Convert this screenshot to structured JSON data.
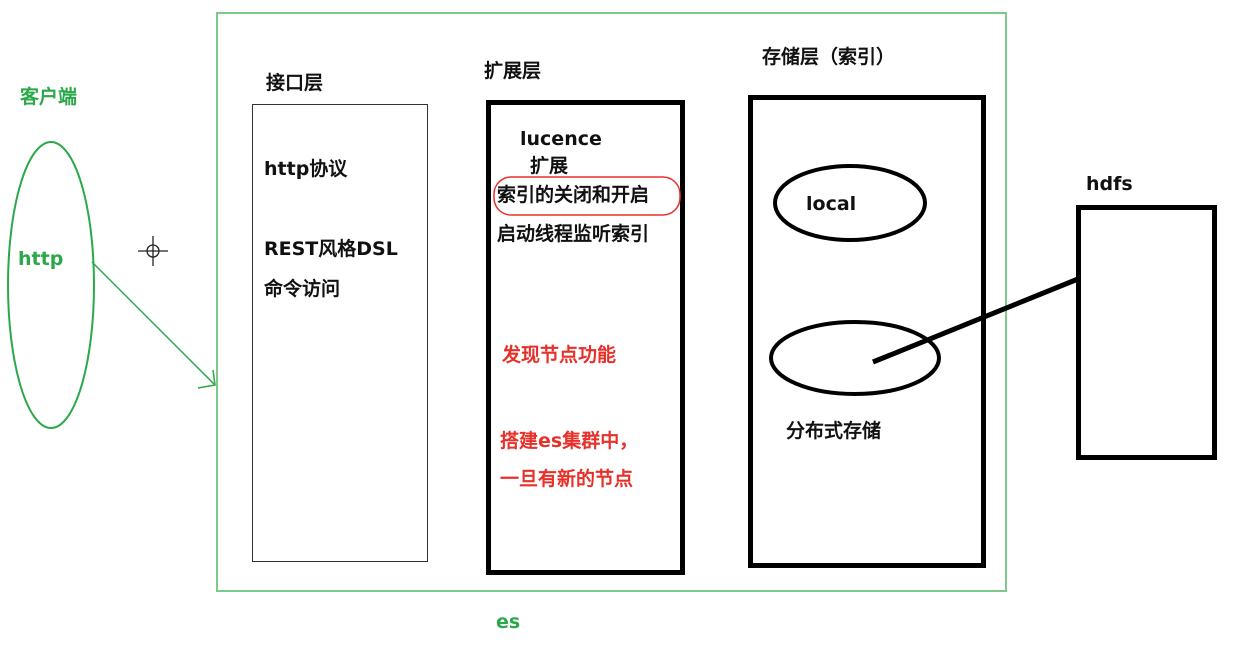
{
  "client": {
    "title": "客户端",
    "protocol": "http"
  },
  "es_label": "es",
  "interface_layer": {
    "title": "接口层",
    "lines": [
      "http协议",
      "REST风格DSL",
      "命令访问"
    ]
  },
  "extension_layer": {
    "title": "扩展层",
    "lines": [
      "lucence",
      "扩展",
      "索引的关闭和开启",
      "启动线程监听索引"
    ],
    "red_lines": [
      "发现节点功能",
      "搭建es集群中，",
      "一旦有新的节点"
    ]
  },
  "storage_layer": {
    "title": "存储层（索引）",
    "local": "local",
    "distributed": "分布式存储"
  },
  "hdfs": {
    "title": "hdfs"
  },
  "colors": {
    "green": "#2aa84a",
    "red": "#e8302a",
    "frame": "#7cc98a",
    "black": "#000000"
  }
}
